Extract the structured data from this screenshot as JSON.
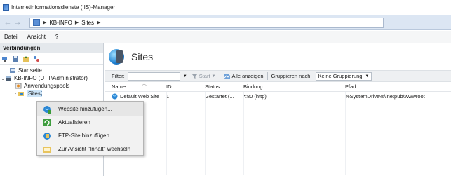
{
  "window": {
    "title": "Internetinformationsdienste (IIS)-Manager"
  },
  "address": {
    "crumbs": [
      "KB-INFO",
      "Sites"
    ]
  },
  "menubar": {
    "items": [
      "Datei",
      "Ansicht",
      "?"
    ]
  },
  "connections": {
    "header": "Verbindungen",
    "tree": [
      {
        "label": "Startseite",
        "toggle": ""
      },
      {
        "label": "KB-INFO (UTT\\Administrator)",
        "toggle": "⌄"
      },
      {
        "label": "Anwendungspools",
        "toggle": ""
      },
      {
        "label": "Sites",
        "toggle": "›"
      }
    ]
  },
  "main": {
    "title": "Sites",
    "filter": {
      "label": "Filter:",
      "start": "Start",
      "show_all": "Alle anzeigen",
      "group_by_label": "Gruppieren nach:",
      "group_by_value": "Keine Gruppierung"
    },
    "columns": [
      "Name",
      "ID:",
      "Status",
      "Bindung",
      "Pfad"
    ],
    "rows": [
      {
        "name": "Default Web Site",
        "id": "1",
        "status": "Gestartet (...",
        "binding": "*:80 (http)",
        "path": "%SystemDrive%\\inetpub\\wwwroot"
      }
    ]
  },
  "context_menu": {
    "items": [
      {
        "label": "Website hinzufügen...",
        "icon": "add-website-icon"
      },
      {
        "label": "Aktualisieren",
        "icon": "refresh-icon"
      },
      {
        "label": "FTP-Site hinzufügen...",
        "icon": "add-ftp-site-icon"
      },
      {
        "label": "Zur Ansicht \"Inhalt\" wechseln",
        "icon": "content-view-icon"
      }
    ]
  },
  "colors": {
    "address_bg": "#dce6f3",
    "selection": "#cce4f7",
    "context_bg": "#f2f2f2"
  }
}
